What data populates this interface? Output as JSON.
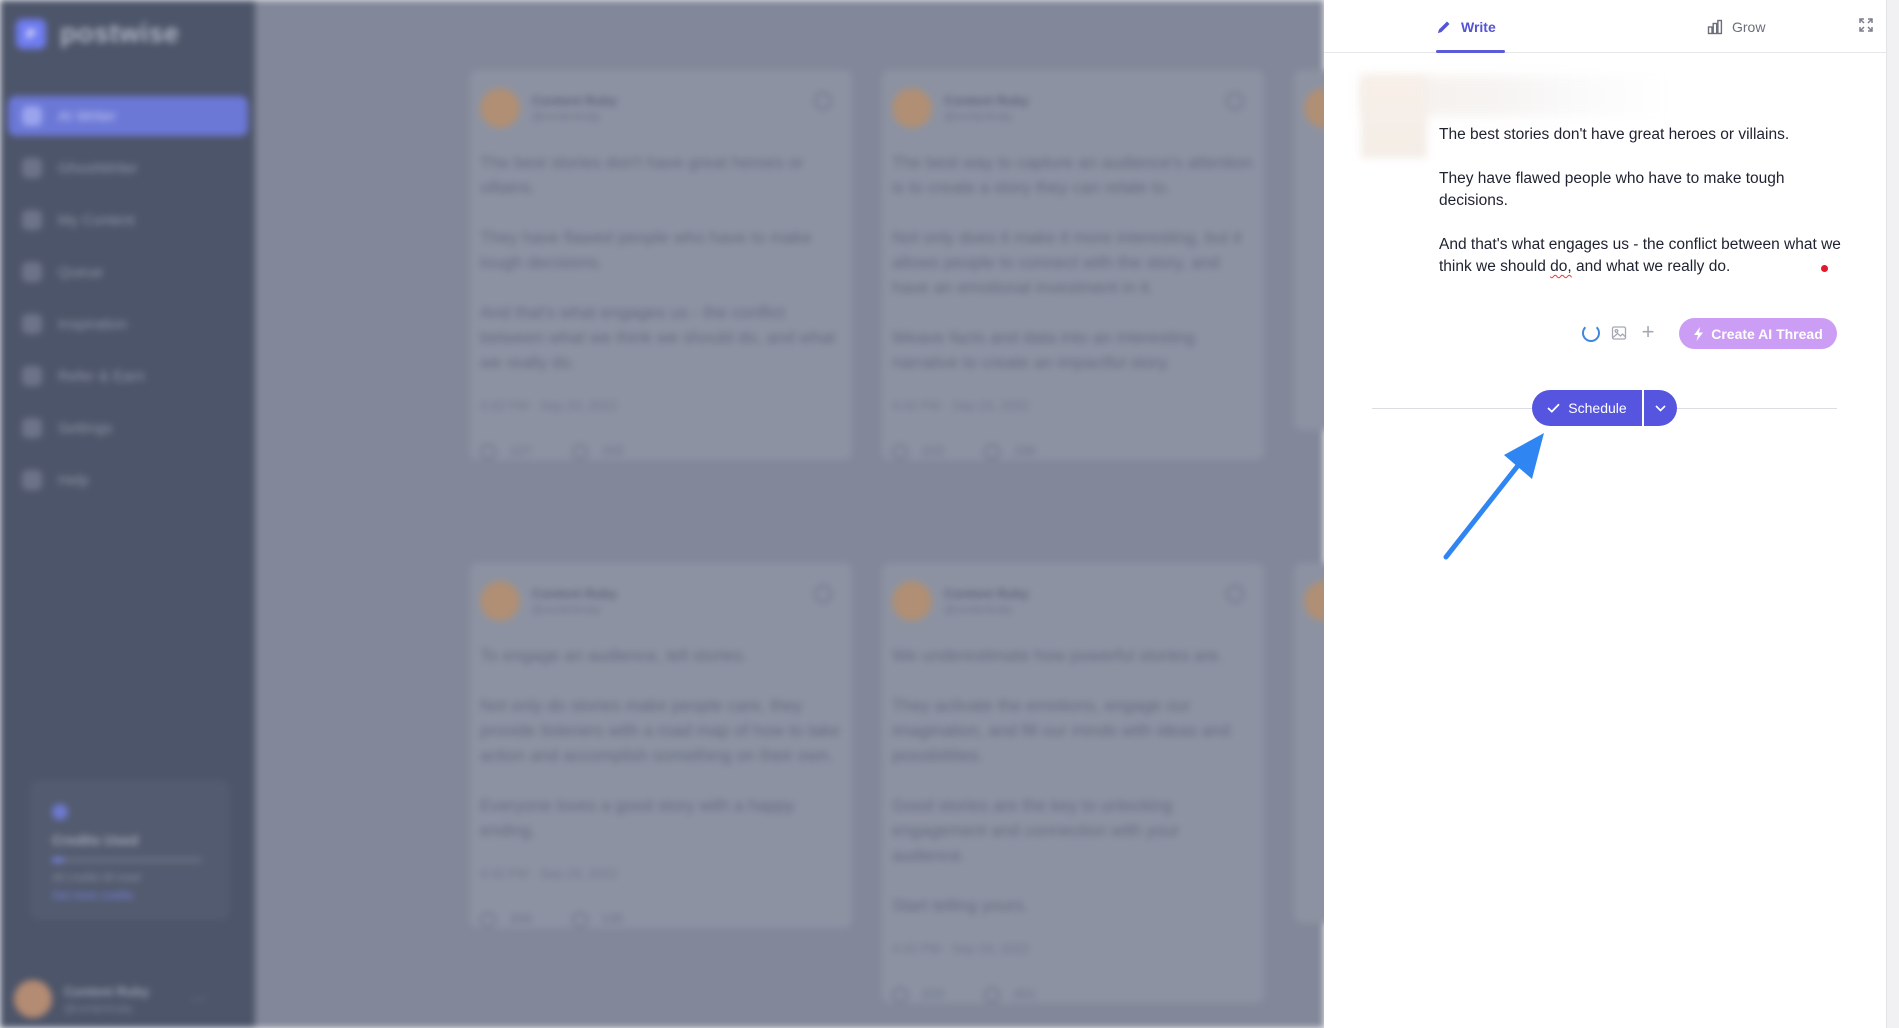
{
  "app": {
    "logo_letter": "P",
    "name": "postwise"
  },
  "sidebar": {
    "items": [
      {
        "label": "AI Writer",
        "icon": "pen-icon"
      },
      {
        "label": "GhostWriter",
        "icon": "user-icon"
      },
      {
        "label": "My Content",
        "icon": "document-icon"
      },
      {
        "label": "Queue",
        "icon": "calendar-icon"
      },
      {
        "label": "Inspiration",
        "icon": "lightbulb-icon"
      },
      {
        "label": "Refer & Earn",
        "icon": "gift-icon"
      },
      {
        "label": "Settings",
        "icon": "gear-icon"
      },
      {
        "label": "Help",
        "icon": "help-icon"
      }
    ],
    "credits": {
      "title": "Credits Used",
      "subtitle": "All credits till reset",
      "link": "Get more credits"
    },
    "user": {
      "name": "Content Ruby",
      "handle": "@contentruby"
    }
  },
  "feed": {
    "cards": [
      {
        "author": "Content Ruby",
        "handle": "@contentruby",
        "paragraphs": [
          "The best stories don't have great heroes or villains.",
          "They have flawed people who have to make tough decisions.",
          "And that's what engages us - the conflict between what we think we should do, and what we really do."
        ],
        "meta": "4:42 PM · Sep 24, 2022",
        "likes": "127",
        "comments": "153"
      },
      {
        "author": "Content Ruby",
        "handle": "@contentruby",
        "paragraphs": [
          "The best way to capture an audience's attention is to create a story they can relate to.",
          "Not only does it make it more interesting, but it allows people to connect with the story, and have an emotional investment in it.",
          "Weave facts and data into an interesting narrative to create an impactful story."
        ],
        "meta": "4:42 PM · Sep 24, 2022",
        "likes": "223",
        "comments": "156"
      },
      {
        "author": "Content Ruby",
        "handle": "@contentruby",
        "paragraphs": [
          "To engage an audience, tell stories.",
          "Not only do stories make people care, they provide listeners with a road map of how to take action and accomplish something on their own.",
          "Everyone loves a good story with a happy ending."
        ],
        "meta": "4:42 PM · Sep 24, 2022",
        "likes": "206",
        "comments": "135"
      },
      {
        "author": "Content Ruby",
        "handle": "@contentruby",
        "paragraphs": [
          "We underestimate how powerful stories are.",
          "They activate the emotions, engage our imagination, and fill our minds with ideas and possibilities.",
          "Good stories are the key to unlocking engagement and connection with your audience.",
          "Start telling yours."
        ],
        "meta": "4:42 PM · Sep 24, 2022",
        "likes": "223",
        "comments": "421"
      }
    ]
  },
  "panel": {
    "tabs": [
      {
        "label": "Write",
        "icon": "pencil-icon",
        "active": true
      },
      {
        "label": "Grow",
        "icon": "bar-chart-icon",
        "active": false
      }
    ],
    "expand_icon": "expand-icon",
    "draft": {
      "p1": "The best stories don't have great heroes or villains.",
      "p2": "They have flawed people who have to make tough decisions.",
      "p3_before": "And that's what engages us - the conflict between what we think we should ",
      "p3_misspelled": "do,",
      "p3_after": " and what we really do."
    },
    "toolbar": {
      "spinner_icon": "loading-spinner-icon",
      "image_icon": "image-icon",
      "add_icon": "plus-icon",
      "ai_button_label": "Create AI Thread"
    },
    "schedule": {
      "label": "Schedule",
      "check_icon": "check-icon",
      "dropdown_icon": "chevron-down-icon"
    }
  },
  "colors": {
    "accent": "#5655e0",
    "ai_button": "#cc9df4",
    "annotation_arrow": "#2f86f2",
    "sidebar_bg": "#4d556a",
    "overlay_bg": "#828899"
  }
}
